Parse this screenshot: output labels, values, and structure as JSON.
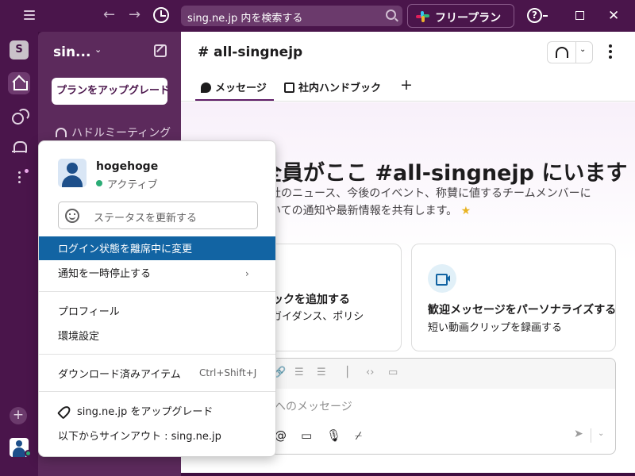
{
  "titlebar": {
    "search_text": "sing.ne.jp 内を検索する",
    "plan_label": "フリープラン",
    "help_glyph": "?"
  },
  "rail": {
    "workspace_initial": "S",
    "add_glyph": "+"
  },
  "sidebar": {
    "workspace_name": "sin...",
    "upgrade_label": "プランをアップグレード",
    "huddles_label": "ハドルミーティング"
  },
  "channel": {
    "title": "# all-singnejp",
    "tabs": [
      {
        "label": "メッセージ"
      },
      {
        "label": "社内ハンドブック"
      }
    ],
    "add_tab_glyph": "+",
    "welcome_title": "全員がここ #all-singnejp にいます",
    "welcome_line1": "社のニュース、今後のイベント、称賛に値するチームメンバーに",
    "welcome_line2": "いての通知や最新情報を共有します。",
    "star_glyph": "★"
  },
  "cards": [
    {
      "title": "ブックを追加する",
      "subtitle": "、ガイダンス、ポリシ"
    },
    {
      "title": "歓迎メッセージをパーソナライズする",
      "subtitle": "短い動画クリップを録画する"
    }
  ],
  "composer": {
    "placeholder": "へのメッセージ"
  },
  "user_menu": {
    "user_name": "hogehoge",
    "status": "アクティブ",
    "status_color": "#2bac76",
    "status_placeholder": "ステータスを更新する",
    "items": [
      {
        "label": "ログイン状態を離席中に変更"
      },
      {
        "label": "通知を一時停止する"
      },
      {
        "label": "プロフィール"
      },
      {
        "label": "環境設定"
      },
      {
        "label": "ダウンロード済みアイテム",
        "shortcut": "Ctrl+Shift+J"
      },
      {
        "label": "sing.ne.jp をアップグレード"
      },
      {
        "label": "以下からサインアウト : sing.ne.jp"
      }
    ],
    "submenu_glyph": "›"
  },
  "colors": {
    "aubergine": "#4a154b",
    "highlight": "#1264a3"
  }
}
